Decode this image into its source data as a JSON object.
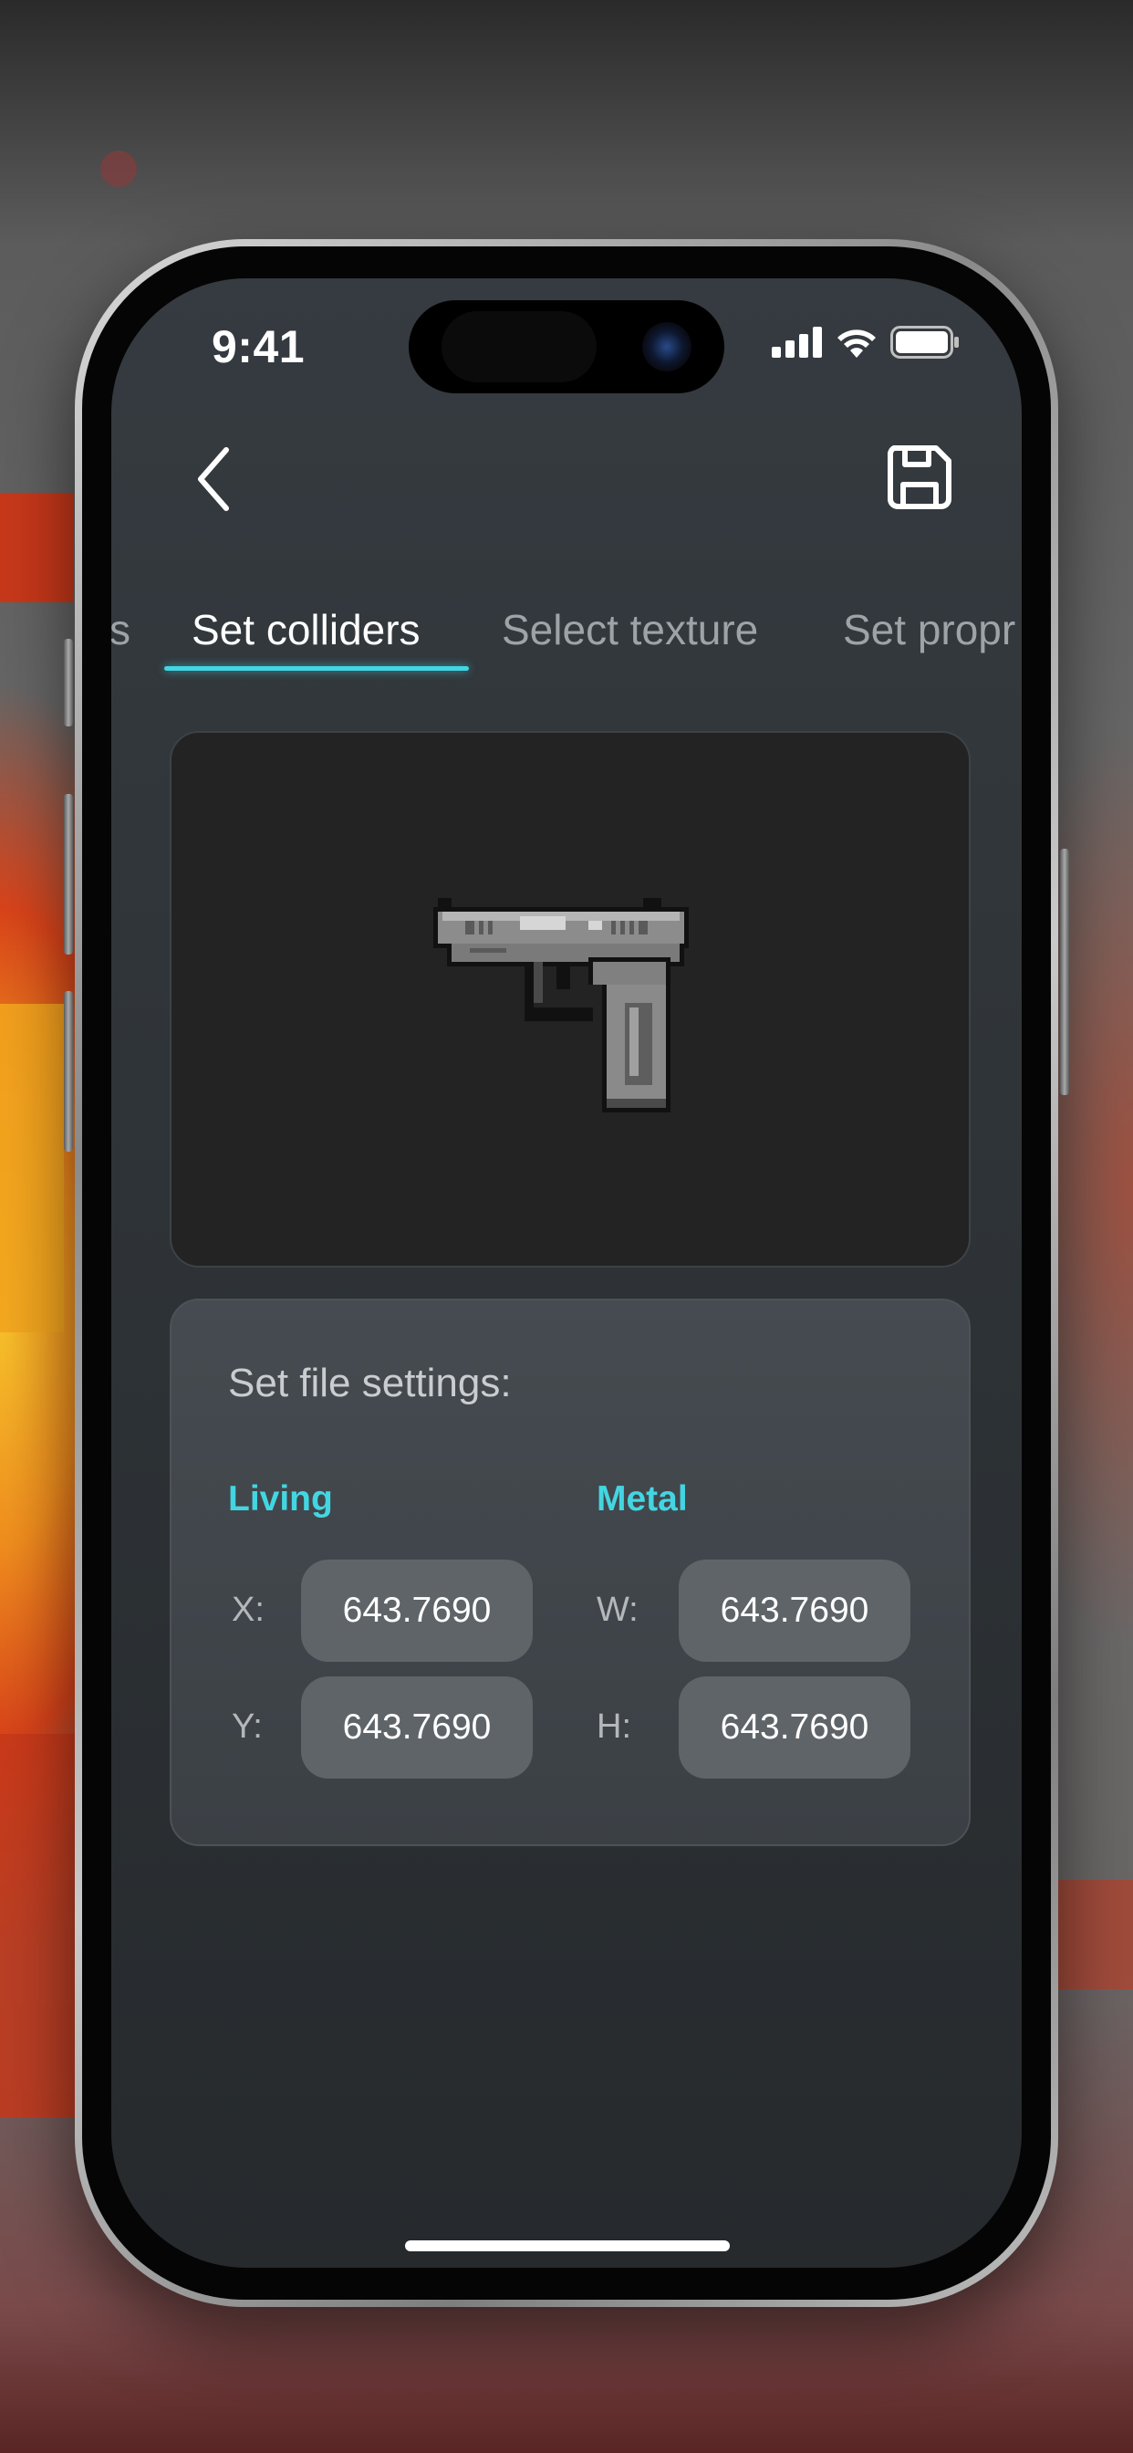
{
  "status_bar": {
    "time": "9:41"
  },
  "header": {
    "back_icon": "chevron-left-icon",
    "save_icon": "floppy-disk-icon"
  },
  "tabs": [
    {
      "label": "s",
      "active": false
    },
    {
      "label": "Set colliders",
      "active": true
    },
    {
      "label": "Select texture",
      "active": false
    },
    {
      "label": "Set propr",
      "active": false
    }
  ],
  "preview": {
    "icon": "pixel-pistol-icon"
  },
  "settings": {
    "title": "Set file settings:",
    "left_group": {
      "label": "Living",
      "fields": [
        {
          "label": "X:",
          "value": "643.7690"
        },
        {
          "label": "Y:",
          "value": "643.7690"
        }
      ]
    },
    "right_group": {
      "label": "Metal",
      "fields": [
        {
          "label": "W:",
          "value": "643.7690"
        },
        {
          "label": "H:",
          "value": "643.7690"
        }
      ]
    }
  },
  "colors": {
    "accent": "#43d6e2",
    "screen_bg": "#2f3438",
    "card_bg": "#3b4045",
    "field_bg": "#5e6468"
  }
}
